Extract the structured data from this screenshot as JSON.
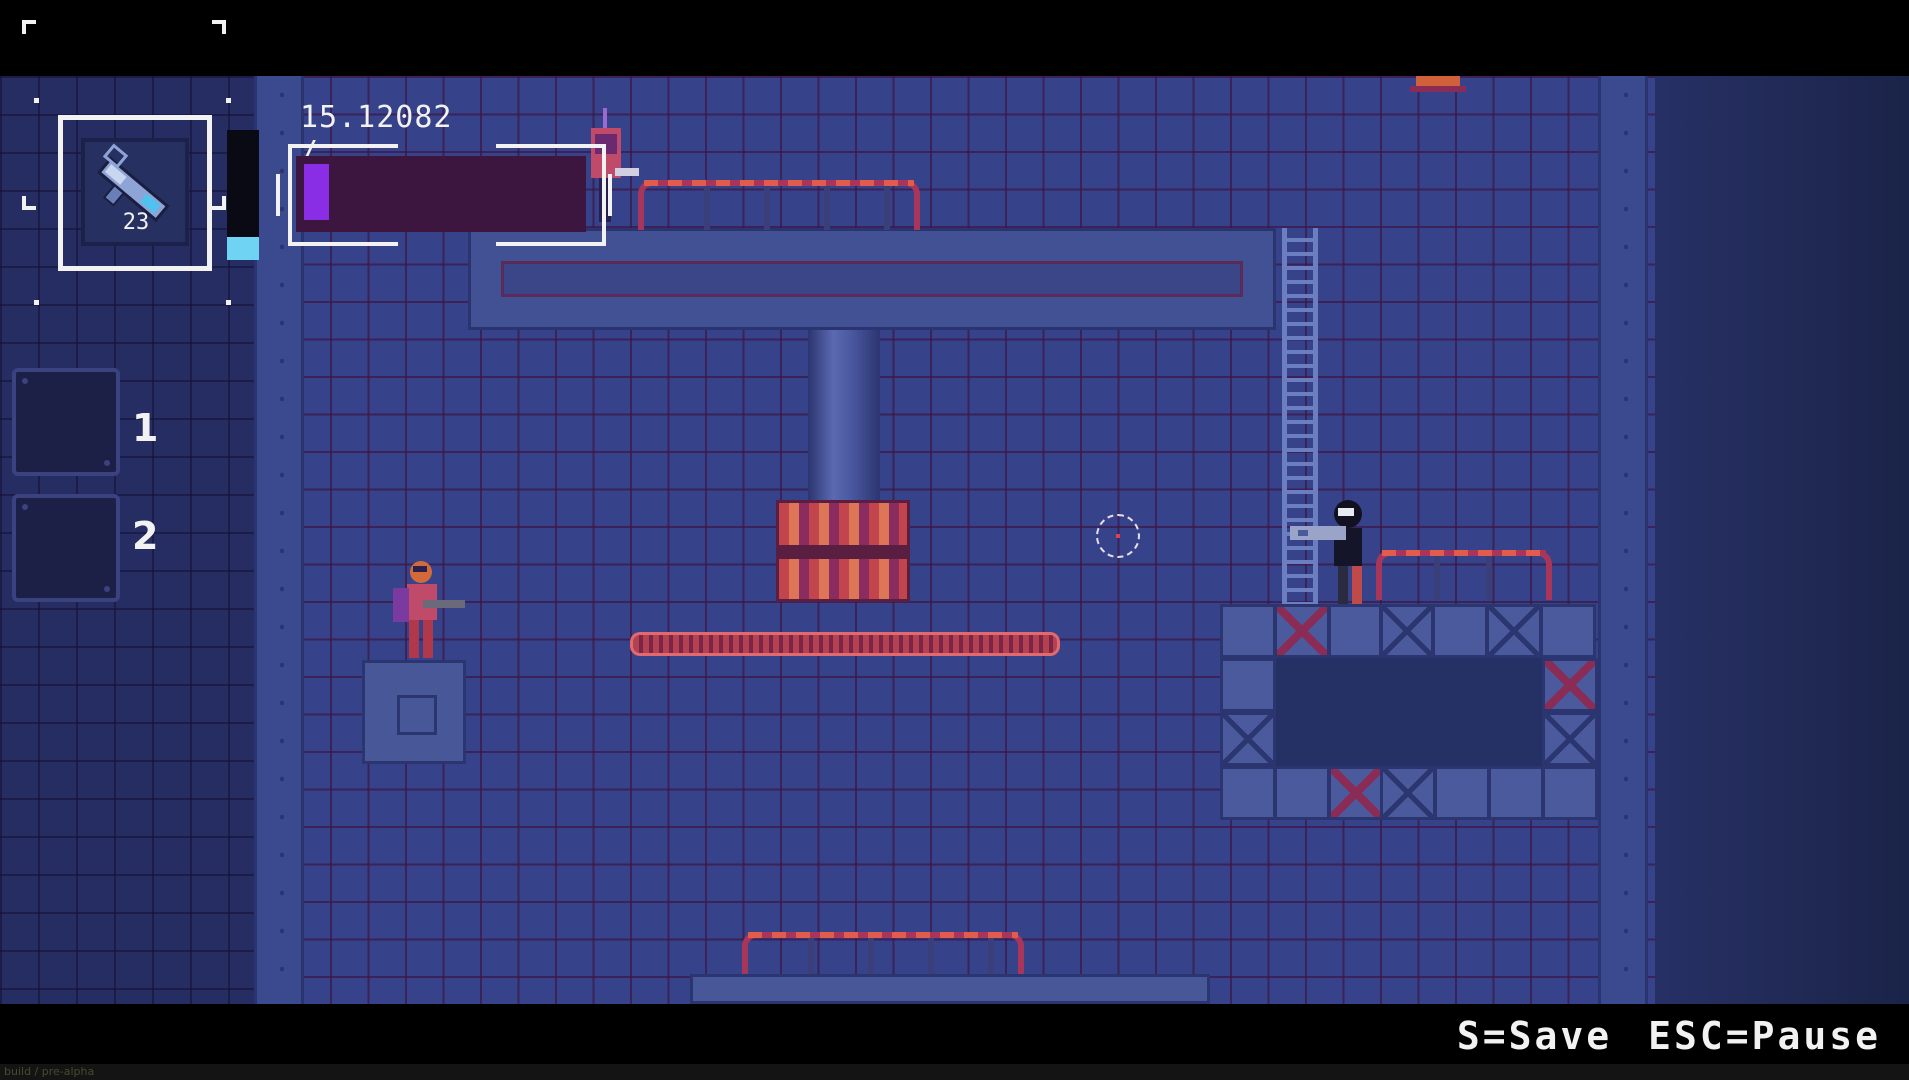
{
  "hud": {
    "stat_readout": "15.12082 /",
    "ammo_count": "23",
    "health_fraction": 0.09,
    "energy_fraction": 0.18,
    "weapon_icon": "energy-rifle-icon",
    "slots": [
      {
        "label": "1"
      },
      {
        "label": "2"
      }
    ]
  },
  "controls": {
    "save_hint": "S=Save",
    "pause_hint": "ESC=Pause"
  },
  "footer": {
    "caption": "build / pre-alpha"
  },
  "colors": {
    "health_fill": "#8a2ee6",
    "health_track": "#3d1640",
    "energy_fill": "#6fd3f3",
    "hud_white": "#f2f2f2"
  }
}
